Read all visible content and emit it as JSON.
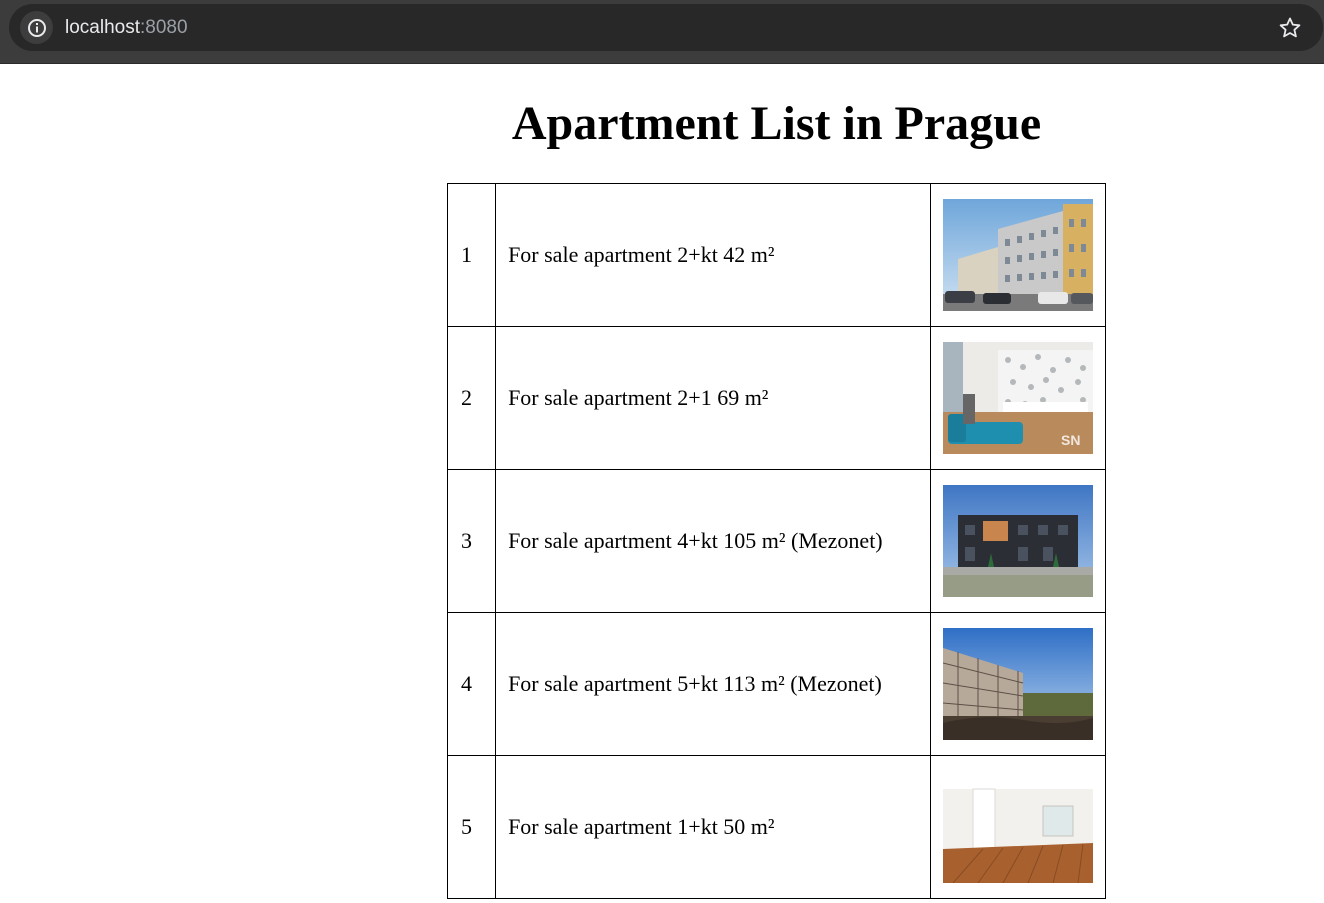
{
  "browser": {
    "url_host": "localhost",
    "url_port": ":8080",
    "info_icon": "info-icon",
    "star_icon": "star-icon"
  },
  "page": {
    "title": "Apartment List in Prague"
  },
  "apartments": [
    {
      "index": "1",
      "description": "For sale apartment 2+kt 42 m²"
    },
    {
      "index": "2",
      "description": "For sale apartment 2+1 69 m²"
    },
    {
      "index": "3",
      "description": "For sale apartment 4+kt 105 m² (Mezonet)"
    },
    {
      "index": "4",
      "description": "For sale apartment 5+kt 113 m² (Mezonet)"
    },
    {
      "index": "5",
      "description": "For sale apartment 1+kt 50 m²"
    }
  ]
}
